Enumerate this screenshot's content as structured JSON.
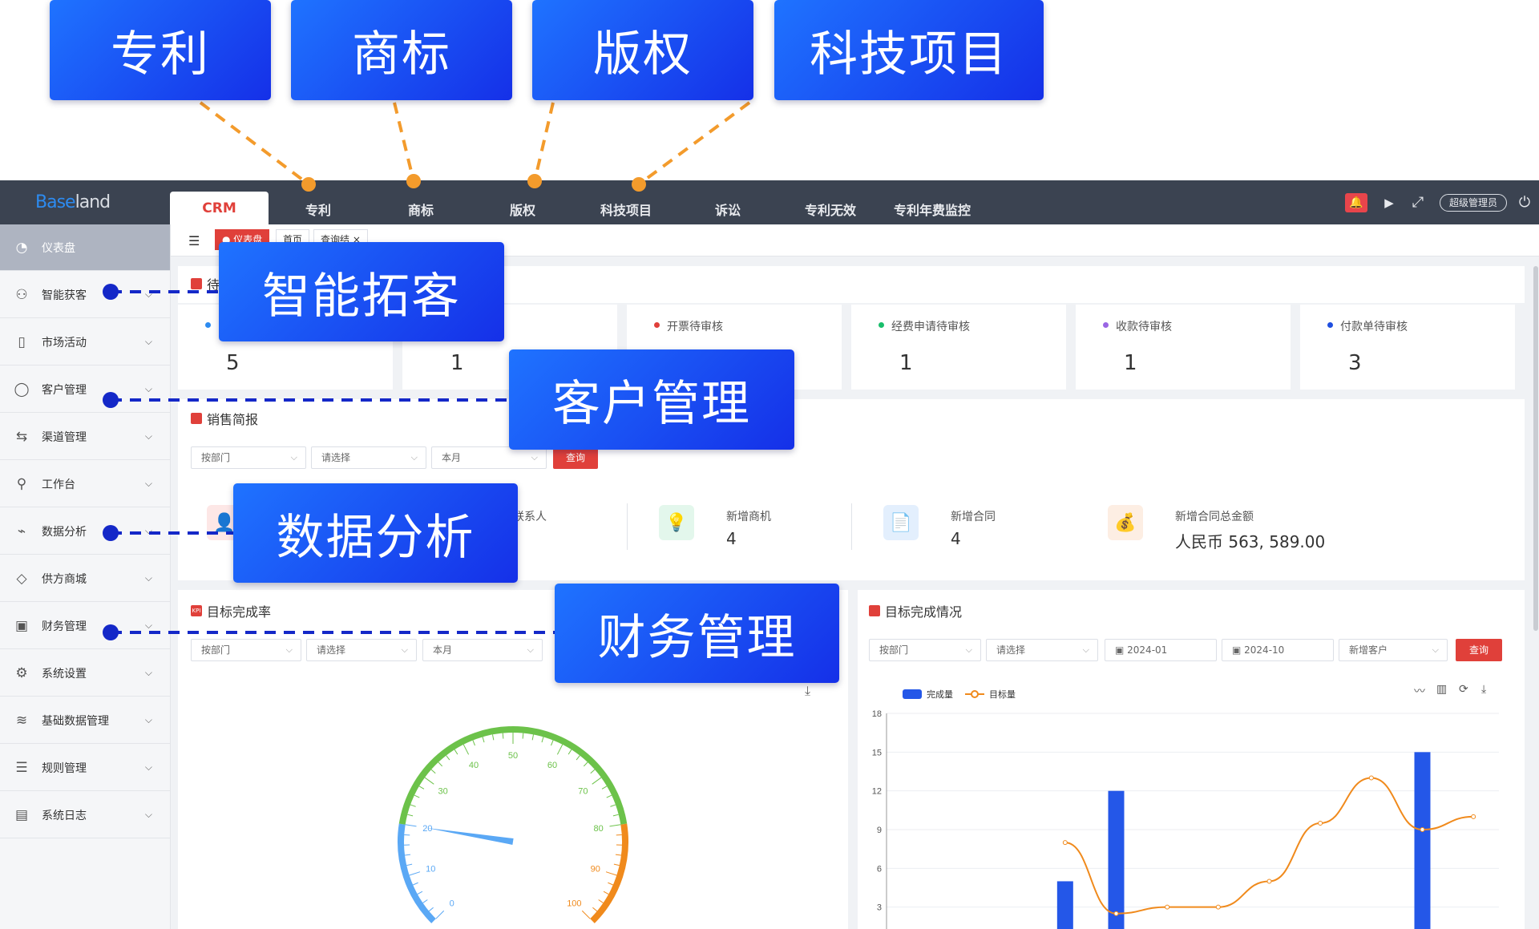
{
  "callouts": {
    "top": [
      "专利",
      "商标",
      "版权",
      "科技项目"
    ],
    "side": [
      "智能拓客",
      "客户管理",
      "数据分析",
      "财务管理"
    ]
  },
  "topbar": {
    "logo_prefix": "Base",
    "logo_suffix": "land",
    "nav": [
      "CRM",
      "专利",
      "商标",
      "版权",
      "科技项目",
      "诉讼",
      "专利无效",
      "专利年费监控"
    ],
    "admin_label": "超级管理员"
  },
  "sidebar": {
    "items": [
      {
        "label": "仪表盘",
        "icon": "dashboard-icon"
      },
      {
        "label": "智能获客",
        "icon": "user-plus-icon"
      },
      {
        "label": "市场活动",
        "icon": "bookmark-icon"
      },
      {
        "label": "客户管理",
        "icon": "user-icon"
      },
      {
        "label": "渠道管理",
        "icon": "channel-icon"
      },
      {
        "label": "工作台",
        "icon": "person-icon"
      },
      {
        "label": "数据分析",
        "icon": "chart-icon"
      },
      {
        "label": "供方商城",
        "icon": "gem-icon"
      },
      {
        "label": "财务管理",
        "icon": "finance-icon"
      },
      {
        "label": "系统设置",
        "icon": "settings-icon"
      },
      {
        "label": "基础数据管理",
        "icon": "layers-icon"
      },
      {
        "label": "规则管理",
        "icon": "sliders-icon"
      },
      {
        "label": "系统日志",
        "icon": "log-icon"
      }
    ]
  },
  "tabs": [
    "仪表盘",
    "首页",
    "查询结"
  ],
  "todo": {
    "title": "待",
    "items": [
      {
        "label": "",
        "value": "5",
        "color": "#2d8bf0"
      },
      {
        "label": "",
        "value": "1",
        "color": "#2d8bf0"
      },
      {
        "label": "开票待审核",
        "value": "",
        "color": "#e0403a"
      },
      {
        "label": "经费申请待审核",
        "value": "1",
        "color": "#19be6b"
      },
      {
        "label": "收款待审核",
        "value": "1",
        "color": "#9a66e4"
      },
      {
        "label": "付款单待审核",
        "value": "3",
        "color": "#1f4fe0"
      }
    ]
  },
  "sales": {
    "title": "销售简报",
    "filters": [
      "按部门",
      "请选择",
      "本月"
    ],
    "query": "查询",
    "stats": [
      {
        "label": "联系人",
        "value": ""
      },
      {
        "label": "新增商机",
        "value": "4"
      },
      {
        "label": "新增合同",
        "value": "4"
      },
      {
        "label": "新增合同总金额",
        "value": "人民币 563, 589.00"
      }
    ]
  },
  "target_rate": {
    "title": "目标完成率",
    "filters": [
      "按部门",
      "请选择",
      "本月"
    ],
    "gauge": {
      "value": 20,
      "min": 0,
      "max": 100,
      "ticks": [
        "0",
        "10",
        "20",
        "30",
        "40",
        "50",
        "60",
        "70",
        "80",
        "90",
        "100"
      ]
    }
  },
  "target_status": {
    "title": "目标完成情况",
    "filters": [
      "按部门",
      "请选择",
      "2024-01",
      "2024-10",
      "新增客户"
    ],
    "query": "查询",
    "legend": [
      "完成量",
      "目标量"
    ]
  },
  "chart_data": {
    "type": "bar",
    "title": "目标完成情况",
    "series": [
      {
        "name": "完成量",
        "type": "bar",
        "values": [
          0,
          0,
          0,
          5,
          12,
          0,
          0,
          0,
          0,
          0,
          15,
          0
        ]
      },
      {
        "name": "目标量",
        "type": "line",
        "values": [
          0,
          0,
          0,
          8,
          2.5,
          3,
          3,
          5,
          9.5,
          13,
          9,
          10
        ]
      }
    ],
    "y_ticks": [
      "3",
      "6",
      "9",
      "12",
      "15",
      "18"
    ],
    "ylim": [
      0,
      18
    ]
  }
}
